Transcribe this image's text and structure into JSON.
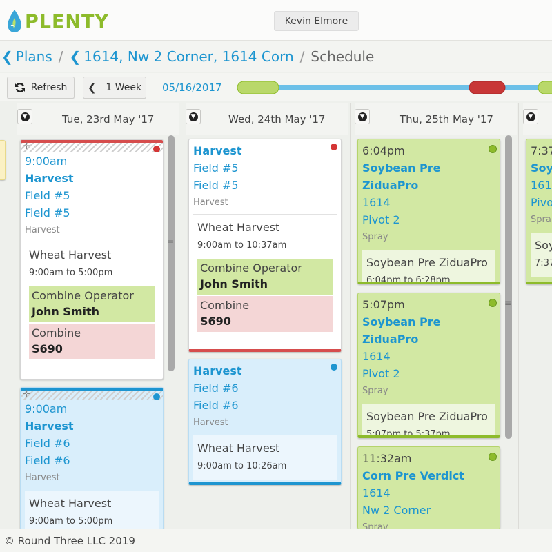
{
  "app": {
    "logo_text": "PLENTY"
  },
  "user": {
    "name": "Kevin Elmore"
  },
  "breadcrumb": {
    "items": [
      "Plans",
      "1614, Nw 2 Corner, 1614 Corn"
    ],
    "current": "Schedule"
  },
  "toolbar": {
    "refresh_label": "Refresh",
    "range_label": "1 Week",
    "date": "05/16/2017"
  },
  "days": [
    {
      "title": "Tue, 23rd May '17"
    },
    {
      "title": "Wed, 24th May '17"
    },
    {
      "title": "Thu, 25th May '17"
    }
  ],
  "colors": {
    "accent": "#1d95d0",
    "brand": "#8dbb2b",
    "red_status": "#d64d4d"
  },
  "tuesday_cards": [
    {
      "time": "9:00am",
      "title": "Harvest",
      "field1": "Field #5",
      "field2": "Field #5",
      "type": "Harvest",
      "task": "Wheat Harvest",
      "task_time": "9:00am to 5:00pm",
      "role_label": "Combine Operator",
      "role_value": "John Smith",
      "equip_label": "Combine",
      "equip_value": "S690"
    },
    {
      "time": "9:00am",
      "title": "Harvest",
      "field1": "Field #6",
      "field2": "Field #6",
      "type": "Harvest",
      "task": "Wheat Harvest",
      "task_time": "9:00am to 5:00pm"
    }
  ],
  "wednesday_cards": [
    {
      "title": "Harvest",
      "field1": "Field #5",
      "field2": "Field #5",
      "type": "Harvest",
      "task": "Wheat Harvest",
      "task_time": "9:00am to 10:37am",
      "role_label": "Combine Operator",
      "role_value": "John Smith",
      "equip_label": "Combine",
      "equip_value": "S690"
    },
    {
      "title": "Harvest",
      "field1": "Field #6",
      "field2": "Field #6",
      "type": "Harvest",
      "task": "Wheat Harvest",
      "task_time": "9:00am to 10:26am"
    }
  ],
  "thursday_cards": [
    {
      "time": "6:04pm",
      "title": "Soybean Pre ZiduaPro",
      "field1": "1614",
      "field2": "Pivot 2",
      "type": "Spray",
      "task": "Soybean Pre ZiduaPro",
      "task_time": "6:04pm to 6:28pm"
    },
    {
      "time": "5:07pm",
      "title": "Soybean Pre ZiduaPro",
      "field1": "1614",
      "field2": "Pivot 2",
      "type": "Spray",
      "task": "Soybean Pre ZiduaPro",
      "task_time": "5:07pm to 5:37pm"
    },
    {
      "time": "11:32am",
      "title": "Corn Pre Verdict",
      "field1": "1614",
      "field2": "Nw 2 Corner",
      "type": "Spray"
    }
  ],
  "friday_partial": {
    "time": "7:37",
    "title": "Soy",
    "field1": "161",
    "field2": "Pivo",
    "type": "Spra",
    "task": "Soy",
    "task_time": "7:37"
  },
  "footer": {
    "text": "© Round Three LLC 2019"
  }
}
